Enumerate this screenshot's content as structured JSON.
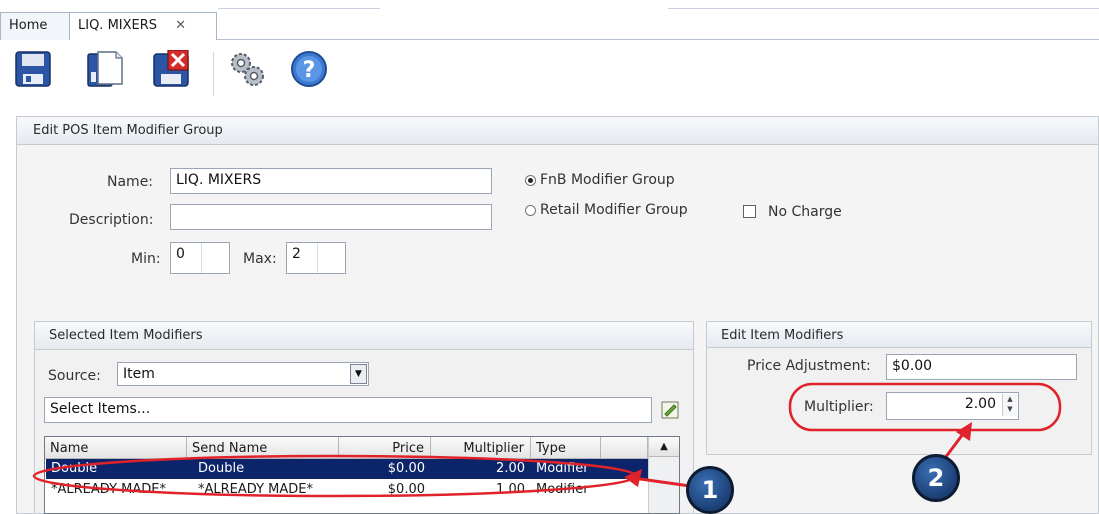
{
  "tabs": [
    {
      "label": "Home"
    },
    {
      "label": "LIQ. MIXERS",
      "close": "✕"
    }
  ],
  "toolbar": {
    "icons": [
      "save-icon",
      "new-icon",
      "delete-icon",
      "settings-icon",
      "help-icon"
    ],
    "help_symbol": "?"
  },
  "edit_group": {
    "title": "Edit POS Item Modifier Group",
    "name_label": "Name:",
    "name_value": "LIQ. MIXERS",
    "description_label": "Description:",
    "description_value": "",
    "min_label": "Min:",
    "min_value": "0",
    "max_label": "Max:",
    "max_value": "2",
    "fnb_label": "FnB Modifier Group",
    "retail_label": "Retail Modifier Group",
    "no_charge_label": "No Charge"
  },
  "selected_modifiers": {
    "title": "Selected Item Modifiers",
    "source_label": "Source:",
    "source_value": "Item",
    "select_items_label": "Select Items...",
    "columns": [
      "Name",
      "Send Name",
      "Price",
      "Multiplier",
      "Type"
    ],
    "rows": [
      {
        "name": "Double",
        "send_name": "Double",
        "price": "$0.00",
        "multiplier": "2.00",
        "type": "Modifier"
      },
      {
        "name": "*ALREADY MADE*",
        "send_name": "*ALREADY MADE*",
        "price": "$0.00",
        "multiplier": "1.00",
        "type": "Modifier"
      }
    ]
  },
  "edit_item_modifiers": {
    "title": "Edit Item Modifiers",
    "price_adjustment_label": "Price Adjustment:",
    "price_adjustment_value": "$0.00",
    "multiplier_label": "Multiplier:",
    "multiplier_value": "2.00"
  },
  "annotations": {
    "callout_1": "1",
    "callout_2": "2",
    "highlight_color": "#e0232b"
  }
}
